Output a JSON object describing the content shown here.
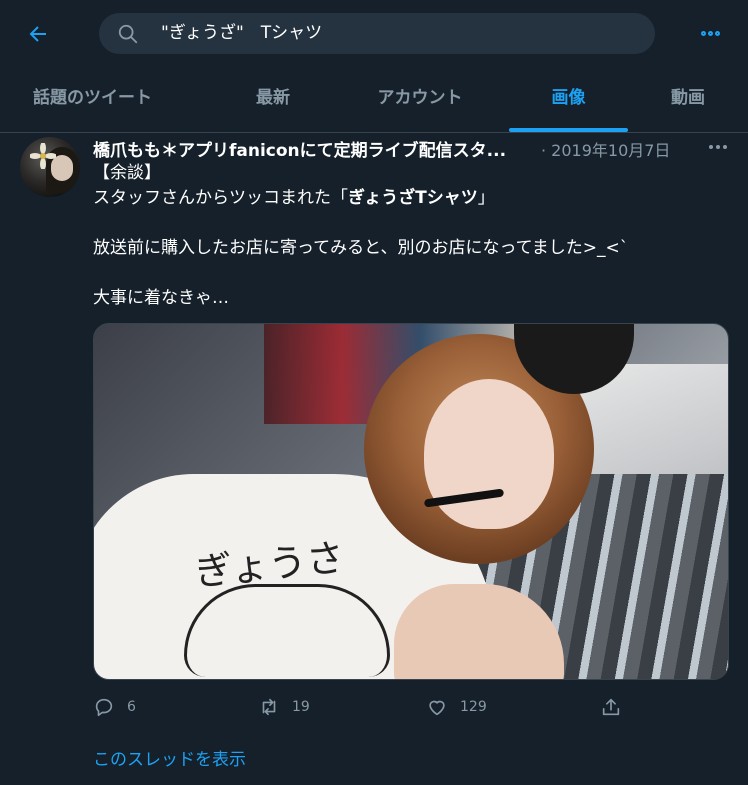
{
  "search": {
    "query": "\"ぎょうざ\"　Tシャツ",
    "back_icon": "arrow-left-icon",
    "search_icon": "search-icon",
    "more_icon": "more-horizontal-icon"
  },
  "tabs": [
    {
      "label": "話題のツイート",
      "active": false
    },
    {
      "label": "最新",
      "active": false
    },
    {
      "label": "アカウント",
      "active": false
    },
    {
      "label": "画像",
      "active": true
    },
    {
      "label": "動画",
      "active": false
    }
  ],
  "tweet": {
    "author": "橋爪もも＊アプリfaniconにて定期ライブ配信スタ...",
    "date": "· 2019年10月7日",
    "text": {
      "line1": "【余談】",
      "line2_prefix": "スタッフさんからツッコまれた「",
      "line2_bold": "ぎょうざTシャツ",
      "line2_suffix": "」",
      "line3": "放送前に購入したお店に寄ってみると、別のお店になってました>_<`",
      "line4": "大事に着なきゃ…"
    },
    "photo_print": "ぎょうさ",
    "actions": {
      "reply_count": "6",
      "retweet_count": "19",
      "like_count": "129"
    },
    "thread_link": "このスレッドを表示"
  },
  "colors": {
    "background": "#15202b",
    "accent": "#1da1f2",
    "muted": "#8899a6",
    "divider": "#38444d"
  }
}
